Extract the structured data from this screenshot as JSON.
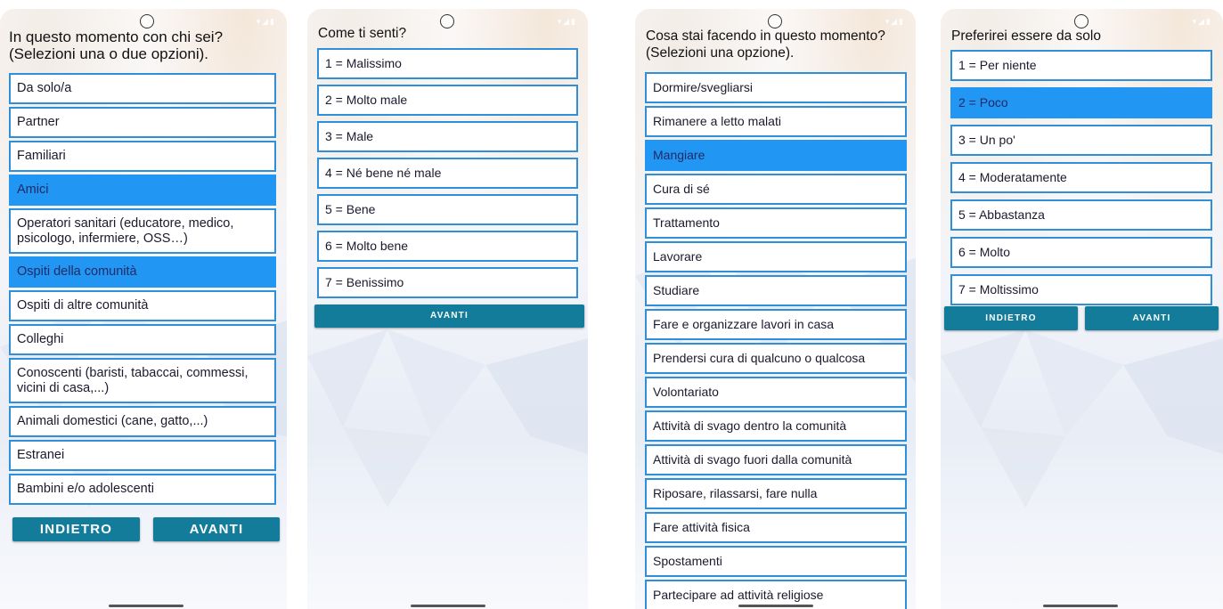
{
  "screens": [
    {
      "question": "In questo momento con chi sei? (Selezioni una o due opzioni).",
      "options": [
        {
          "label": "Da solo/a",
          "selected": false
        },
        {
          "label": "Partner",
          "selected": false
        },
        {
          "label": "Familiari",
          "selected": false
        },
        {
          "label": "Amici",
          "selected": true
        },
        {
          "label": "Operatori sanitari (educatore, medico, psicologo, infermiere, OSS…)",
          "selected": false
        },
        {
          "label": "Ospiti della comunità",
          "selected": true
        },
        {
          "label": "Ospiti di altre comunità",
          "selected": false
        },
        {
          "label": "Colleghi",
          "selected": false
        },
        {
          "label": "Conoscenti (baristi, tabaccai, commessi, vicini di casa,...)",
          "selected": false
        },
        {
          "label": "Animali domestici (cane, gatto,...)",
          "selected": false
        },
        {
          "label": "Estranei",
          "selected": false
        },
        {
          "label": "Bambini e/o adolescenti",
          "selected": false
        }
      ],
      "back_label": "INDIETRO",
      "next_label": "AVANTI"
    },
    {
      "question": "Come ti senti?",
      "options": [
        {
          "label": "1 = Malissimo",
          "selected": false
        },
        {
          "label": "2 = Molto male",
          "selected": false
        },
        {
          "label": "3 = Male",
          "selected": false
        },
        {
          "label": "4 = Né bene né male",
          "selected": false
        },
        {
          "label": "5 = Bene",
          "selected": false
        },
        {
          "label": "6 = Molto bene",
          "selected": false
        },
        {
          "label": "7 = Benissimo",
          "selected": false
        }
      ],
      "next_label": "AVANTI"
    },
    {
      "question": "Cosa stai facendo in questo momento? (Selezioni una  opzione).",
      "options": [
        {
          "label": "Dormire/svegliarsi",
          "selected": false
        },
        {
          "label": "Rimanere a letto malati",
          "selected": false
        },
        {
          "label": "Mangiare",
          "selected": true
        },
        {
          "label": "Cura di sé",
          "selected": false
        },
        {
          "label": "Trattamento",
          "selected": false
        },
        {
          "label": "Lavorare",
          "selected": false
        },
        {
          "label": "Studiare",
          "selected": false
        },
        {
          "label": "Fare e organizzare lavori in casa",
          "selected": false
        },
        {
          "label": "Prendersi cura di qualcuno o qualcosa",
          "selected": false
        },
        {
          "label": "Volontariato",
          "selected": false
        },
        {
          "label": "Attività di svago dentro la comunità",
          "selected": false
        },
        {
          "label": "Attività di svago fuori dalla comunità",
          "selected": false
        },
        {
          "label": "Riposare, rilassarsi, fare nulla",
          "selected": false
        },
        {
          "label": "Fare attività fisica",
          "selected": false
        },
        {
          "label": "Spostamenti",
          "selected": false
        },
        {
          "label": "Partecipare ad attività religiose",
          "selected": false
        }
      ]
    },
    {
      "question": "Preferirei essere da solo",
      "options": [
        {
          "label": "1 = Per niente",
          "selected": false
        },
        {
          "label": "2 = Poco",
          "selected": true
        },
        {
          "label": "3 = Un po'",
          "selected": false
        },
        {
          "label": "4 = Moderatamente",
          "selected": false
        },
        {
          "label": "5 = Abbastanza",
          "selected": false
        },
        {
          "label": "6 = Molto",
          "selected": false
        },
        {
          "label": "7 = Moltissimo",
          "selected": false
        }
      ],
      "back_label": "INDIETRO",
      "next_label": "AVANTI"
    }
  ],
  "colors": {
    "selected": "#2196f3",
    "border": "#2f8fd8",
    "button": "#137c9a"
  }
}
